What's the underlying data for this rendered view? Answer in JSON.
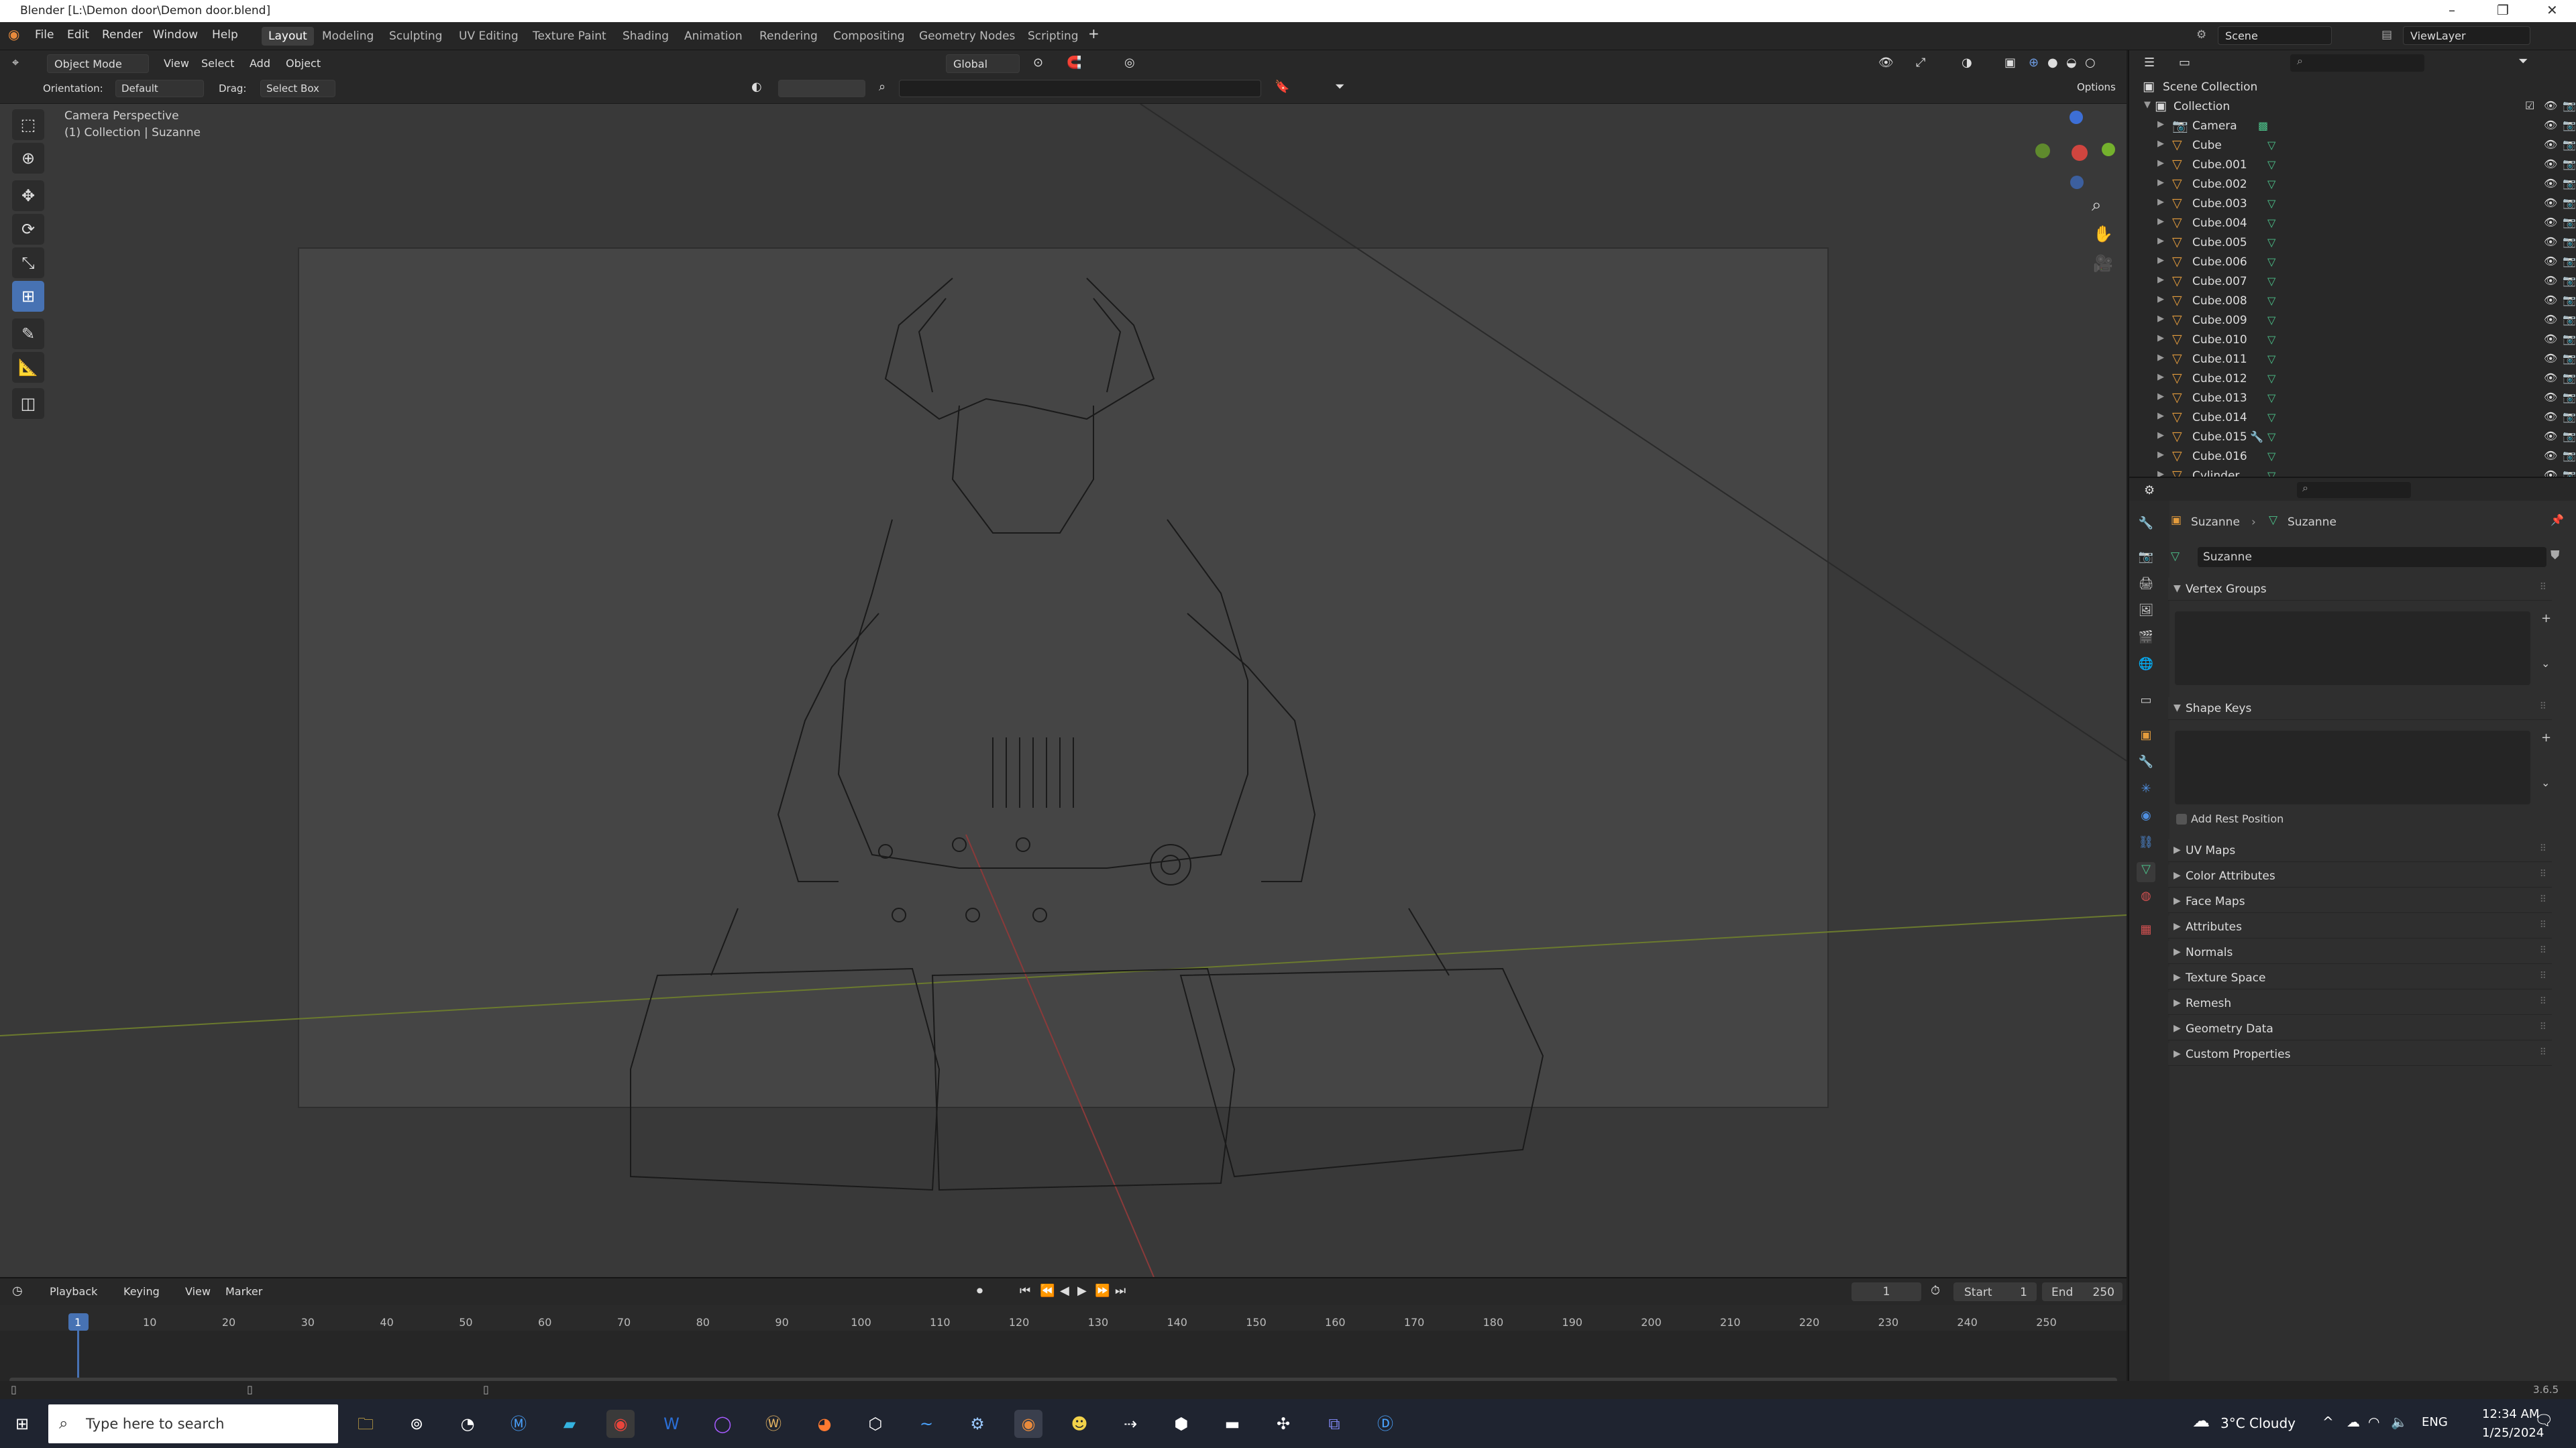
{
  "window": {
    "title": "Blender [L:\\Demon door\\Demon door.blend]"
  },
  "menus": [
    "File",
    "Edit",
    "Render",
    "Window",
    "Help"
  ],
  "workspaces": [
    "Layout",
    "Modeling",
    "Sculpting",
    "UV Editing",
    "Texture Paint",
    "Shading",
    "Animation",
    "Rendering",
    "Compositing",
    "Geometry Nodes",
    "Scripting"
  ],
  "active_workspace": "Layout",
  "scene": {
    "name": "Scene",
    "view_layer": "ViewLayer"
  },
  "header": {
    "mode": "Object Mode",
    "view": "View",
    "select": "Select",
    "add": "Add",
    "object": "Object",
    "transform": "Global",
    "orientation_label": "Orientation:",
    "orientation_value": "Default",
    "drag_label": "Drag:",
    "drag_value": "Select Box",
    "options": "Options"
  },
  "viewport": {
    "line1": "Camera Perspective",
    "line2": "(1) Collection | Suzanne"
  },
  "outliner": {
    "root": "Scene Collection",
    "collection": "Collection",
    "items": [
      "Camera",
      "Cube",
      "Cube.001",
      "Cube.002",
      "Cube.003",
      "Cube.004",
      "Cube.005",
      "Cube.006",
      "Cube.007",
      "Cube.008",
      "Cube.009",
      "Cube.010",
      "Cube.011",
      "Cube.012",
      "Cube.013",
      "Cube.014",
      "Cube.015",
      "Cube.016",
      "Cylinder"
    ]
  },
  "properties": {
    "breadcrumb_object": "Suzanne",
    "breadcrumb_data": "Suzanne",
    "data_name": "Suzanne",
    "vertex_groups": "Vertex Groups",
    "shape_keys": "Shape Keys",
    "add_rest_position": "Add Rest Position",
    "panels": [
      "UV Maps",
      "Color Attributes",
      "Face Maps",
      "Attributes",
      "Normals",
      "Texture Space",
      "Remesh",
      "Geometry Data",
      "Custom Properties"
    ]
  },
  "timeline": {
    "menus": [
      "Playback",
      "Keying",
      "View",
      "Marker"
    ],
    "current_frame": "1",
    "start_label": "Start",
    "start": "1",
    "end_label": "End",
    "end": "250",
    "ticks": [
      "1",
      "10",
      "20",
      "30",
      "40",
      "50",
      "60",
      "70",
      "80",
      "90",
      "100",
      "110",
      "120",
      "130",
      "140",
      "150",
      "160",
      "170",
      "180",
      "190",
      "200",
      "210",
      "220",
      "230",
      "240",
      "250"
    ]
  },
  "status": {
    "version": "3.6.5"
  },
  "taskbar": {
    "search_placeholder": "Type here to search",
    "weather": "3°C  Cloudy",
    "lang": "ENG",
    "time": "12:34 AM",
    "date": "1/25/2024"
  }
}
